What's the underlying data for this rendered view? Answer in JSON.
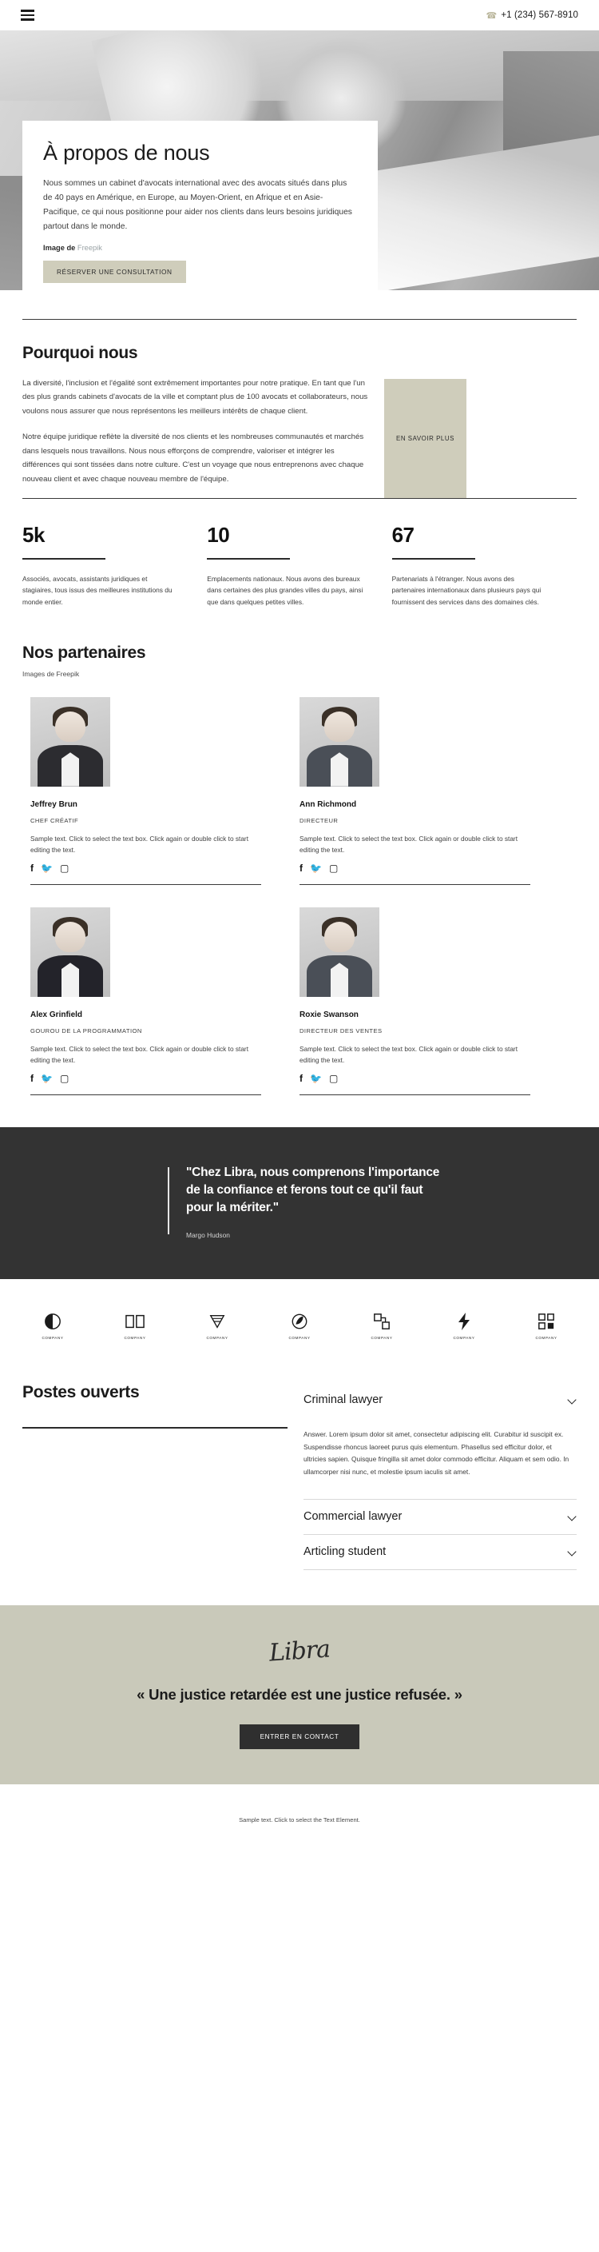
{
  "header": {
    "menu_icon": "hamburger-menu-icon",
    "phone_icon": "phone-icon",
    "phone": "+1 (234) 567-8910"
  },
  "hero": {
    "title": "À propos de nous",
    "paragraph": "Nous sommes un cabinet d'avocats international avec des avocats situés dans plus de 40 pays en Amérique, en Europe, au Moyen-Orient, en Afrique et en Asie-Pacifique, ce qui nous positionne pour aider nos clients dans leurs besoins juridiques partout dans le monde.",
    "credit_prefix": "Image de ",
    "credit_link": "Freepik",
    "cta_label": "RÉSERVER UNE CONSULTATION"
  },
  "why": {
    "title": "Pourquoi nous",
    "paragraph1": "La diversité, l'inclusion et l'égalité sont extrêmement importantes pour notre pratique. En tant que l'un des plus grands cabinets d'avocats de la ville et comptant plus de 100 avocats et collaborateurs, nous voulons nous assurer que nous représentons les meilleurs intérêts de chaque client.",
    "paragraph2": "Notre équipe juridique reflète la diversité de nos clients et les nombreuses communautés et marchés dans lesquels nous travaillons. Nous nous efforçons de comprendre, valoriser et intégrer les différences qui sont tissées dans notre culture. C'est un voyage que nous entreprenons avec chaque nouveau client et avec chaque nouveau membre de l'équipe.",
    "cta_label": "EN SAVOIR PLUS"
  },
  "stats": [
    {
      "number": "5k",
      "description": "Associés, avocats, assistants juridiques et stagiaires, tous issus des meilleures institutions du monde entier."
    },
    {
      "number": "10",
      "description": "Emplacements nationaux. Nous avons des bureaux dans certaines des plus grandes villes du pays, ainsi que dans quelques petites villes."
    },
    {
      "number": "67",
      "description": "Partenariats à l'étranger. Nous avons des partenaires internationaux dans plusieurs pays qui fournissent des services dans des domaines clés."
    }
  ],
  "partners": {
    "title": "Nos partenaires",
    "subtitle": "Images de Freepik",
    "members": [
      {
        "name": "Jeffrey Brun",
        "role": "CHEF CRÉATIF",
        "bio": "Sample text. Click to select the text box. Click again or double click to start editing the text.",
        "socials": [
          "facebook-icon",
          "twitter-icon",
          "instagram-icon"
        ]
      },
      {
        "name": "Ann Richmond",
        "role": "DIRECTEUR",
        "bio": "Sample text. Click to select the text box. Click again or double click to start editing the text.",
        "socials": [
          "facebook-icon",
          "twitter-icon",
          "instagram-icon"
        ]
      },
      {
        "name": "Alex Grinfield",
        "role": "GOUROU DE LA PROGRAMMATION",
        "bio": "Sample text. Click to select the text box. Click again or double click to start editing the text.",
        "socials": [
          "facebook-icon",
          "twitter-icon",
          "instagram-icon"
        ]
      },
      {
        "name": "Roxie Swanson",
        "role": "DIRECTEUR DES VENTES",
        "bio": "Sample text. Click to select the text box. Click again or double click to start editing the text.",
        "socials": [
          "facebook-icon",
          "twitter-icon",
          "instagram-icon"
        ]
      }
    ]
  },
  "quote": {
    "text": "\"Chez Libra, nous comprenons l'importance de la confiance et ferons tout ce qu'il faut pour la mériter.\"",
    "author": "Margo Hudson"
  },
  "logos": [
    {
      "label": "COMPANY",
      "mark": "circle-eclipse-logo-icon"
    },
    {
      "label": "COMPANY",
      "mark": "open-book-logo-icon"
    },
    {
      "label": "COMPANY",
      "mark": "feather-stripes-logo-icon"
    },
    {
      "label": "COMPANY",
      "mark": "leaf-circle-logo-icon"
    },
    {
      "label": "COMPANY",
      "mark": "squares-logo-icon"
    },
    {
      "label": "COMPANY",
      "mark": "lightning-logo-icon"
    },
    {
      "label": "COMPANY",
      "mark": "blocks-logo-icon"
    }
  ],
  "jobs": {
    "title": "Postes ouverts",
    "items": [
      {
        "title": "Criminal lawyer",
        "expanded": true,
        "body": "Answer. Lorem ipsum dolor sit amet, consectetur adipiscing elit. Curabitur id suscipit ex. Suspendisse rhoncus laoreet purus quis elementum. Phasellus sed efficitur dolor, et ultricies sapien. Quisque fringilla sit amet dolor commodo efficitur. Aliquam et sem odio. In ullamcorper nisi nunc, et molestie ipsum iaculis sit amet."
      },
      {
        "title": "Commercial lawyer",
        "expanded": false,
        "body": ""
      },
      {
        "title": "Articling student",
        "expanded": false,
        "body": ""
      }
    ]
  },
  "cta": {
    "signature": "Libra",
    "title": "« Une justice retardée est une justice refusée. »",
    "button_label": "ENTRER EN CONTACT"
  },
  "footer": {
    "text": "Sample text. Click to select the Text Element."
  },
  "colors": {
    "tan_button": "#cfcdbb",
    "dark_band": "#333333",
    "cta_band": "#c9c9ba",
    "dark_button": "#2f2f2f",
    "link": "#9aa3a6"
  }
}
